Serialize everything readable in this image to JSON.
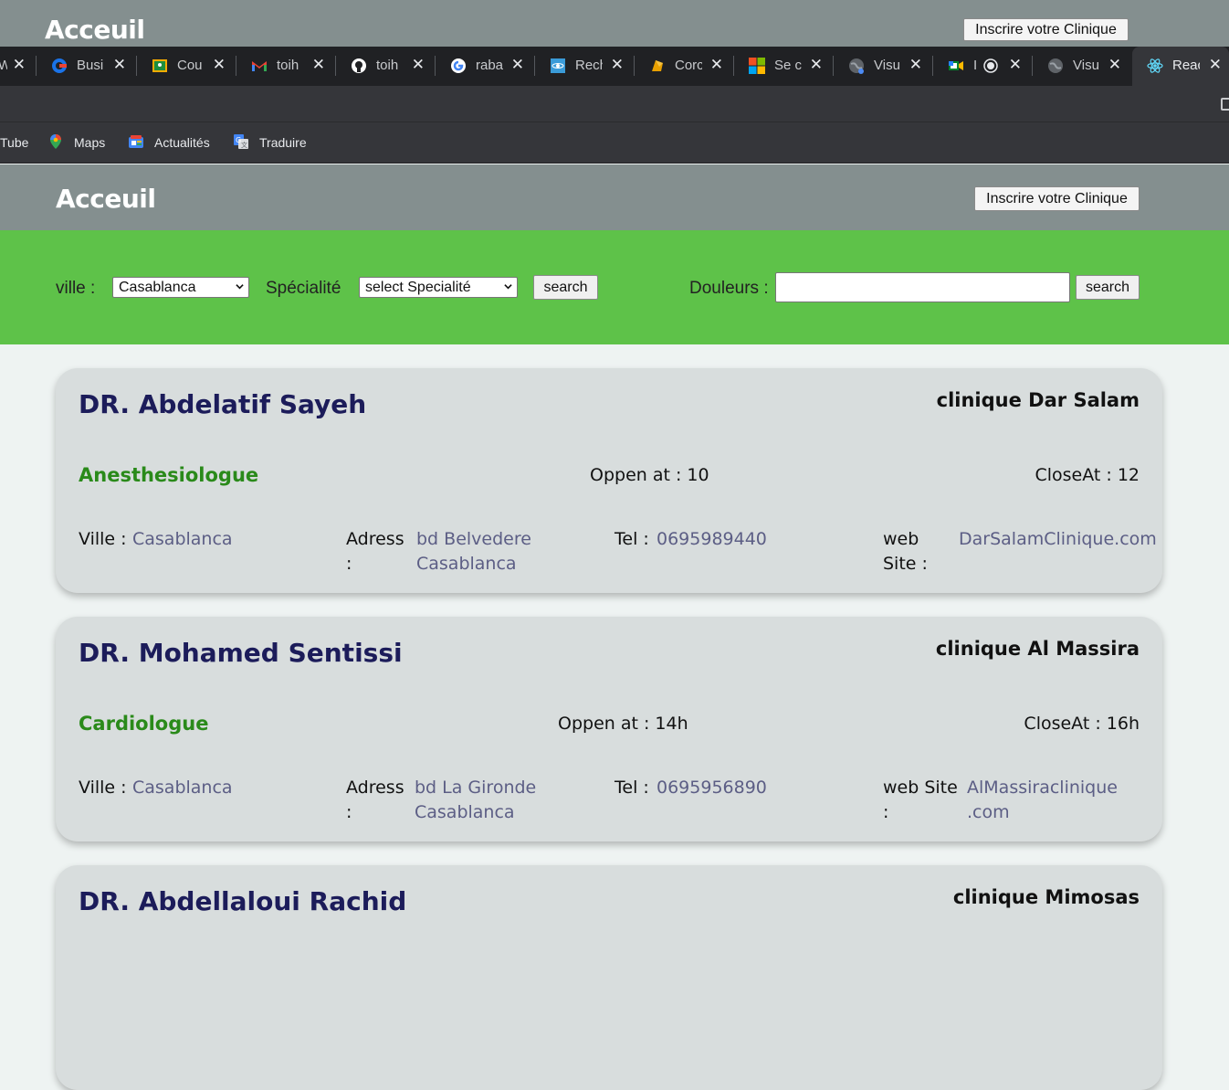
{
  "ghost_header": {
    "title": "Acceuil",
    "button": "Inscrire votre Clinique"
  },
  "browser": {
    "tabs": [
      {
        "label": "W",
        "icon": "partial-tab-icon"
      },
      {
        "label": "Busi",
        "icon": "business-icon"
      },
      {
        "label": "Cou",
        "icon": "classroom-icon"
      },
      {
        "label": "toih",
        "icon": "gmail-icon"
      },
      {
        "label": "toih",
        "icon": "github-icon"
      },
      {
        "label": "raba",
        "icon": "google-icon"
      },
      {
        "label": "Rech",
        "icon": "react-site-icon"
      },
      {
        "label": "Corc",
        "icon": "cordova-icon"
      },
      {
        "label": "Se c",
        "icon": "microsoft-icon"
      },
      {
        "label": "Visu",
        "icon": "globe-icon"
      },
      {
        "label": "I",
        "icon": "meet-icon"
      },
      {
        "label": "Visu",
        "icon": "globe-icon"
      },
      {
        "label": "Reac",
        "icon": "react-icon"
      }
    ],
    "bookmarks": [
      "Tube",
      "Maps",
      "Actualités",
      "Traduire"
    ]
  },
  "header": {
    "title": "Acceuil",
    "button": "Inscrire votre Clinique"
  },
  "filters": {
    "ville_label": "ville :",
    "ville_value": "Casablanca",
    "specialite_label": "Spécialité",
    "specialite_value": "select Specialité",
    "search1": "search",
    "douleurs_label": "Douleurs :",
    "douleurs_value": "",
    "search2": "search"
  },
  "doctors": [
    {
      "name": "DR. Abdelatif Sayeh",
      "clinic": "clinique Dar Salam",
      "specialty": "Anesthesiologue",
      "open": "Oppen at : 10",
      "close": "CloseAt : 12",
      "ville_label": "Ville :",
      "ville": "Casablanca",
      "adress_label_1": "Adress",
      "adress_label_2": ":",
      "adress_1": "bd Belvedere",
      "adress_2": "Casablanca",
      "tel_label": "Tel :",
      "tel": "0695989440",
      "web_label_1": "web",
      "web_label_2": "Site :",
      "web_1": "DarSalamClinique.com",
      "web_2": ""
    },
    {
      "name": "DR. Mohamed Sentissi",
      "clinic": "clinique Al Massira",
      "specialty": "Cardiologue",
      "open": "Oppen at : 14h",
      "close": "CloseAt : 16h",
      "ville_label": "Ville :",
      "ville": "Casablanca",
      "adress_label_1": "Adress",
      "adress_label_2": ":",
      "adress_1": "bd La Gironde",
      "adress_2": "Casablanca",
      "tel_label": "Tel :",
      "tel": "0695956890",
      "web_label_1": "web Site",
      "web_label_2": ":",
      "web_1": "AlMassiraclinique",
      "web_2": ".com"
    },
    {
      "name": "DR. Abdellaloui Rachid",
      "clinic": "clinique Mimosas"
    }
  ]
}
